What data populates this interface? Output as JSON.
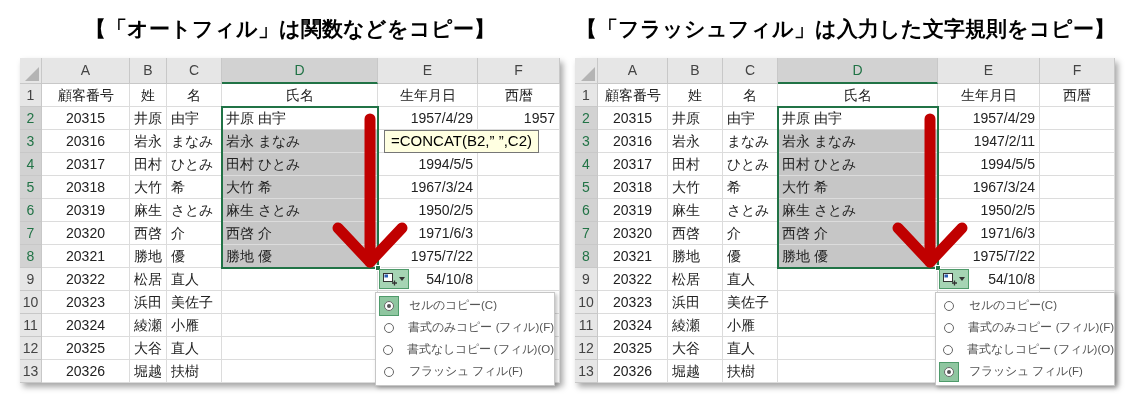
{
  "panels": [
    {
      "title": "【「オートフィル」は関数などをコピー】",
      "sheet": {
        "columns": [
          {
            "label": "A",
            "selected": false
          },
          {
            "label": "B",
            "selected": false
          },
          {
            "label": "C",
            "selected": false
          },
          {
            "label": "D",
            "selected": true
          },
          {
            "label": "E",
            "selected": false
          },
          {
            "label": "F",
            "selected": false
          }
        ],
        "rows": [
          {
            "label": "1",
            "selected": false,
            "cells": [
              "顧客番号",
              "姓",
              "名",
              "氏名",
              "生年月日",
              "西暦"
            ]
          },
          {
            "label": "2",
            "selected": true,
            "cells": [
              "20315",
              "井原",
              "由宇",
              "井原 由宇",
              "1957/4/29",
              "1957"
            ]
          },
          {
            "label": "3",
            "selected": true,
            "cells": [
              "20316",
              "岩永",
              "まなみ",
              "岩永 まなみ",
              null,
              null
            ]
          },
          {
            "label": "4",
            "selected": true,
            "cells": [
              "20317",
              "田村",
              "ひとみ",
              "田村 ひとみ",
              "1994/5/5",
              null
            ]
          },
          {
            "label": "5",
            "selected": true,
            "cells": [
              "20318",
              "大竹",
              "希",
              "大竹 希",
              "1967/3/24",
              null
            ]
          },
          {
            "label": "6",
            "selected": true,
            "cells": [
              "20319",
              "麻生",
              "さとみ",
              "麻生 さとみ",
              "1950/2/5",
              null
            ]
          },
          {
            "label": "7",
            "selected": true,
            "cells": [
              "20320",
              "西啓",
              "介",
              "西啓 介",
              "1971/6/3",
              null
            ]
          },
          {
            "label": "8",
            "selected": true,
            "cells": [
              "20321",
              "勝地",
              "優",
              "勝地 優",
              "1975/7/22",
              null
            ]
          },
          {
            "label": "9",
            "selected": false,
            "cells": [
              "20322",
              "松居",
              "直人",
              null,
              "54/10/8",
              null
            ]
          },
          {
            "label": "10",
            "selected": false,
            "cells": [
              "20323",
              "浜田",
              "美佐子",
              null,
              null,
              null
            ]
          },
          {
            "label": "11",
            "selected": false,
            "cells": [
              "20324",
              "綾瀬",
              "小雁",
              null,
              null,
              null
            ]
          },
          {
            "label": "12",
            "selected": false,
            "cells": [
              "20325",
              "大谷",
              "直人",
              null,
              null,
              null
            ]
          },
          {
            "label": "13",
            "selected": false,
            "cells": [
              "20326",
              "堀越",
              "扶樹",
              null,
              null,
              null
            ]
          }
        ]
      },
      "tooltip": "=CONCAT(B2,” ”,C2)",
      "fill_menu": [
        {
          "label": "セルのコピー(C)",
          "selected": true
        },
        {
          "label": "書式のみコピー (フィル)(F)",
          "selected": false
        },
        {
          "label": "書式なしコピー (フィル)(O)",
          "selected": false
        },
        {
          "label": "フラッシュ フィル(F)",
          "selected": false
        }
      ]
    },
    {
      "title": "【「フラッシュフィル」は入力した文字規則をコピー】",
      "sheet": {
        "columns": [
          {
            "label": "A",
            "selected": false
          },
          {
            "label": "B",
            "selected": false
          },
          {
            "label": "C",
            "selected": false
          },
          {
            "label": "D",
            "selected": true
          },
          {
            "label": "E",
            "selected": false
          },
          {
            "label": "F",
            "selected": false
          }
        ],
        "rows": [
          {
            "label": "1",
            "selected": false,
            "cells": [
              "顧客番号",
              "姓",
              "名",
              "氏名",
              "生年月日",
              "西暦"
            ]
          },
          {
            "label": "2",
            "selected": true,
            "cells": [
              "20315",
              "井原",
              "由宇",
              "井原 由宇",
              "1957/4/29",
              null
            ]
          },
          {
            "label": "3",
            "selected": true,
            "cells": [
              "20316",
              "岩永",
              "まなみ",
              "岩永 まなみ",
              "1947/2/11",
              null
            ]
          },
          {
            "label": "4",
            "selected": true,
            "cells": [
              "20317",
              "田村",
              "ひとみ",
              "田村 ひとみ",
              "1994/5/5",
              null
            ]
          },
          {
            "label": "5",
            "selected": true,
            "cells": [
              "20318",
              "大竹",
              "希",
              "大竹 希",
              "1967/3/24",
              null
            ]
          },
          {
            "label": "6",
            "selected": true,
            "cells": [
              "20319",
              "麻生",
              "さとみ",
              "麻生 さとみ",
              "1950/2/5",
              null
            ]
          },
          {
            "label": "7",
            "selected": true,
            "cells": [
              "20320",
              "西啓",
              "介",
              "西啓 介",
              "1971/6/3",
              null
            ]
          },
          {
            "label": "8",
            "selected": true,
            "cells": [
              "20321",
              "勝地",
              "優",
              "勝地 優",
              "1975/7/22",
              null
            ]
          },
          {
            "label": "9",
            "selected": false,
            "cells": [
              "20322",
              "松居",
              "直人",
              null,
              "54/10/8",
              null
            ]
          },
          {
            "label": "10",
            "selected": false,
            "cells": [
              "20323",
              "浜田",
              "美佐子",
              null,
              null,
              null
            ]
          },
          {
            "label": "11",
            "selected": false,
            "cells": [
              "20324",
              "綾瀬",
              "小雁",
              null,
              null,
              null
            ]
          },
          {
            "label": "12",
            "selected": false,
            "cells": [
              "20325",
              "大谷",
              "直人",
              null,
              null,
              null
            ]
          },
          {
            "label": "13",
            "selected": false,
            "cells": [
              "20326",
              "堀越",
              "扶樹",
              null,
              null,
              null
            ]
          }
        ]
      },
      "fill_menu": [
        {
          "label": "セルのコピー(C)",
          "selected": false
        },
        {
          "label": "書式のみコピー (フィル)(F)",
          "selected": false
        },
        {
          "label": "書式なしコピー (フィル)(O)",
          "selected": false
        },
        {
          "label": "フラッシュ フィル(F)",
          "selected": true
        }
      ]
    }
  ]
}
